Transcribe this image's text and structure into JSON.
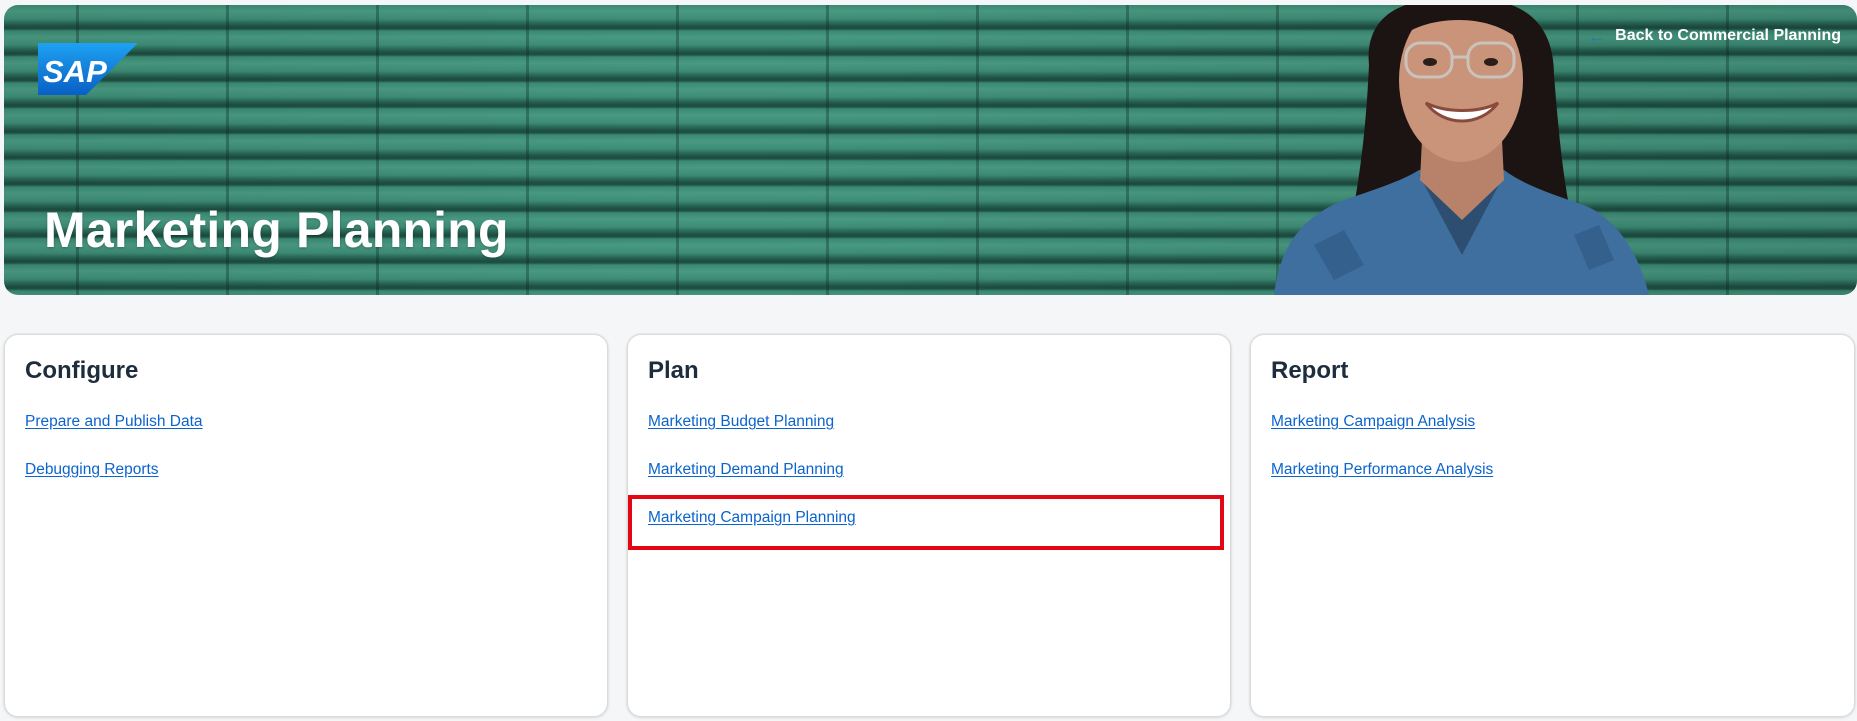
{
  "header": {
    "back_label": "Back to Commercial Planning",
    "title": "Marketing Planning",
    "logo_text": "SAP"
  },
  "cards": [
    {
      "title": "Configure",
      "links": [
        "Prepare and Publish Data",
        "Debugging Reports"
      ]
    },
    {
      "title": "Plan",
      "links": [
        "Marketing Budget Planning",
        "Marketing Demand Planning",
        "Marketing Campaign Planning"
      ]
    },
    {
      "title": "Report",
      "links": [
        "Marketing Campaign Analysis",
        "Marketing Performance Analysis"
      ]
    }
  ],
  "icons": {
    "back": "arrow-left-icon",
    "logo": "sap-logo"
  },
  "colors": {
    "link": "#0b64cc",
    "highlight": "#e30613",
    "banner": "#2f7c66",
    "title": "#1d2d3e"
  }
}
